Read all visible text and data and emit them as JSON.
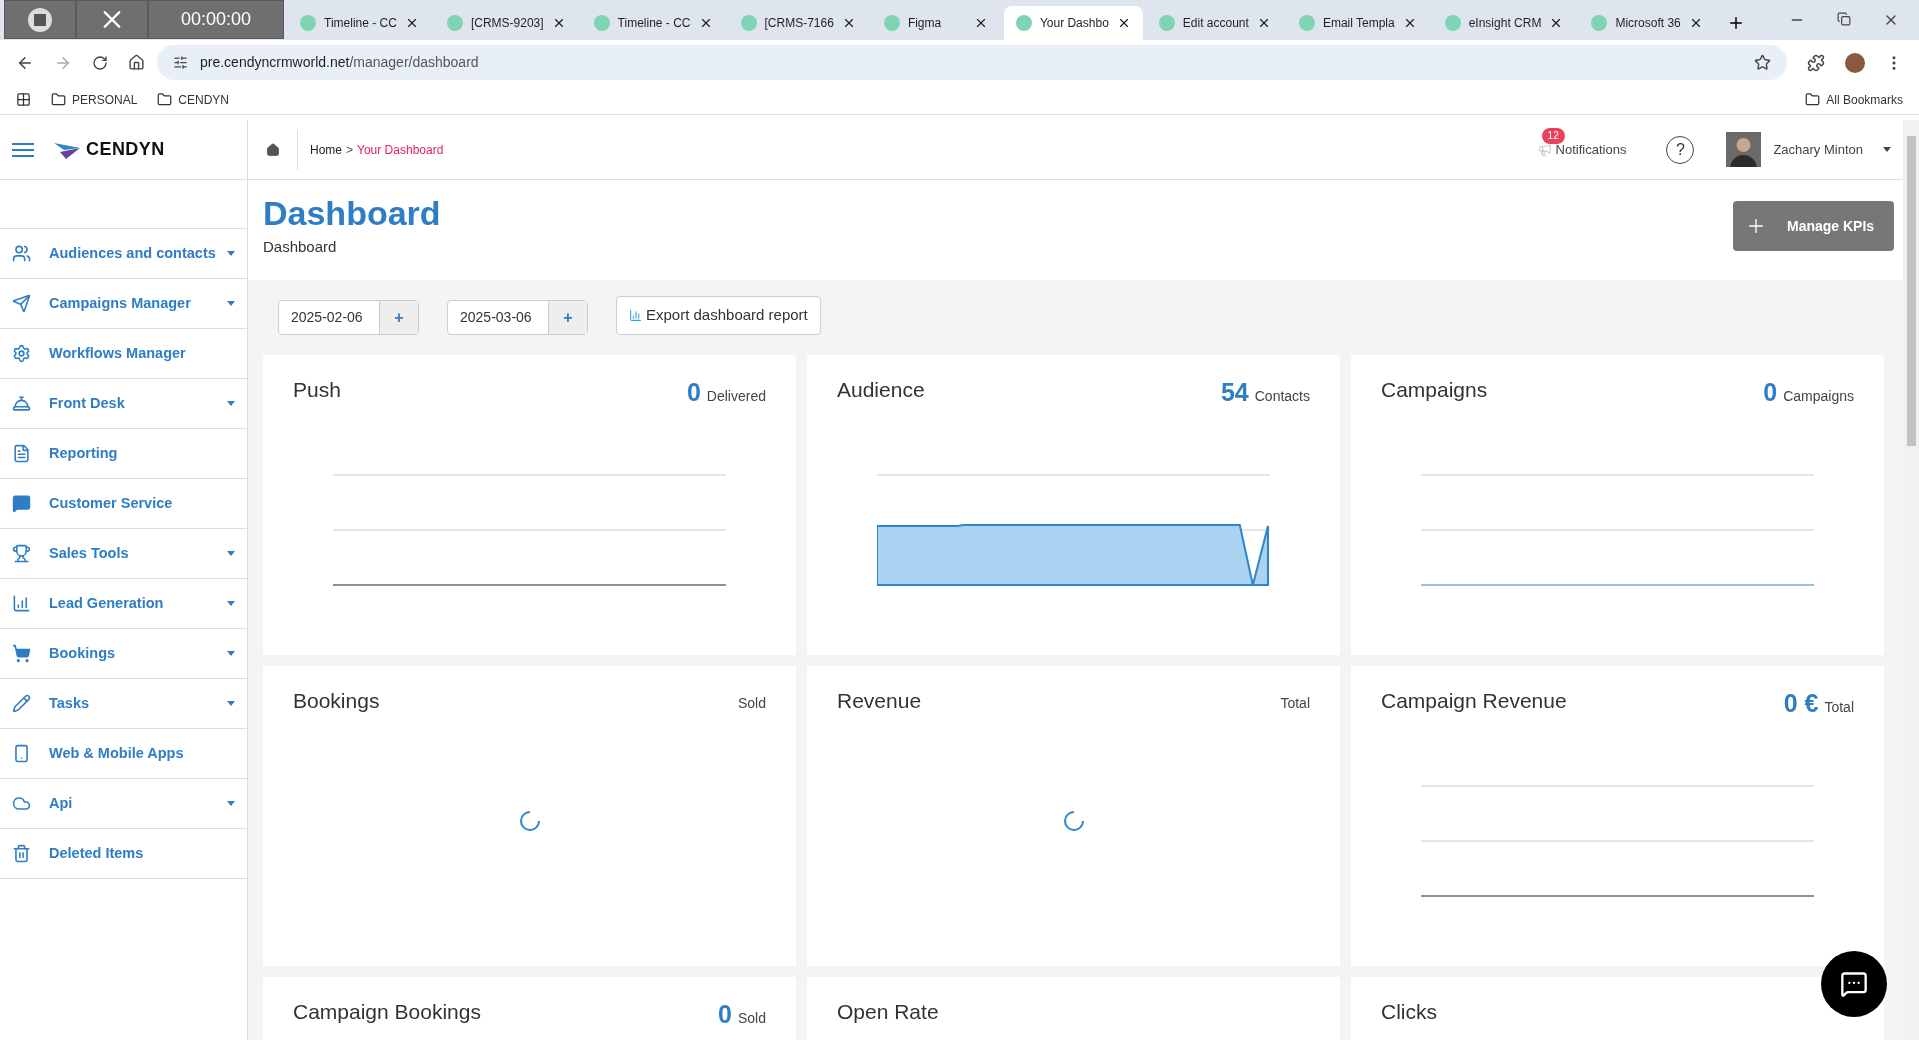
{
  "browser": {
    "recorder": {
      "time": "00:00:00"
    },
    "tabs": [
      {
        "title": "Timeline - CC",
        "selected": false
      },
      {
        "title": "[CRMS-9203]",
        "selected": false
      },
      {
        "title": "Timeline - CC",
        "selected": false
      },
      {
        "title": "[CRMS-7166",
        "selected": false
      },
      {
        "title": "Figma",
        "selected": false
      },
      {
        "title": "Your Dashbo",
        "selected": true
      },
      {
        "title": "Edit account",
        "selected": false
      },
      {
        "title": "Email Templa",
        "selected": false
      },
      {
        "title": "eInsight CRM",
        "selected": false
      },
      {
        "title": "Microsoft 36",
        "selected": false
      }
    ],
    "url": {
      "host": "pre.cendyncrmworld.net",
      "path": "/manager/dashboard"
    },
    "bookmarks": [
      "PERSONAL",
      "CENDYN"
    ],
    "all_bookmarks": "All Bookmarks"
  },
  "app": {
    "logo": "CENDYN",
    "breadcrumb": {
      "home": "Home",
      "separator": ">",
      "current": "Your Dashboard"
    },
    "notifications": {
      "label": "Notifications",
      "count": "12"
    },
    "help": "?",
    "user": {
      "name": "Zachary Minton"
    }
  },
  "sidebar": {
    "items": [
      {
        "label": "Audiences and contacts",
        "has_submenu": true
      },
      {
        "label": "Campaigns Manager",
        "has_submenu": true
      },
      {
        "label": "Workflows Manager",
        "has_submenu": false
      },
      {
        "label": "Front Desk",
        "has_submenu": true
      },
      {
        "label": "Reporting",
        "has_submenu": false
      },
      {
        "label": "Customer Service",
        "has_submenu": false
      },
      {
        "label": "Sales Tools",
        "has_submenu": true
      },
      {
        "label": "Lead Generation",
        "has_submenu": true
      },
      {
        "label": "Bookings",
        "has_submenu": true
      },
      {
        "label": "Tasks",
        "has_submenu": true
      },
      {
        "label": "Web & Mobile Apps",
        "has_submenu": false
      },
      {
        "label": "Api",
        "has_submenu": true
      },
      {
        "label": "Deleted Items",
        "has_submenu": false
      }
    ]
  },
  "page": {
    "title": "Dashboard",
    "subtitle": "Dashboard",
    "manage_button": "Manage KPIs",
    "dates": [
      "2025-02-06",
      "2025-03-06"
    ],
    "date_button": "+",
    "export_button": "Export dashboard report"
  },
  "cards": [
    {
      "title": "Push",
      "value": "0",
      "unit": "Delivered",
      "kind": "empty"
    },
    {
      "title": "Audience",
      "value": "54",
      "unit": "Contacts",
      "kind": "area"
    },
    {
      "title": "Campaigns",
      "value": "0",
      "unit": "Campaigns",
      "kind": "empty_blue"
    },
    {
      "title": "Bookings",
      "unit": "Sold",
      "kind": "loading"
    },
    {
      "title": "Revenue",
      "unit": "Total",
      "kind": "loading"
    },
    {
      "title": "Campaign Revenue",
      "value": "0 €",
      "unit": "Total",
      "kind": "empty"
    },
    {
      "title": "Campaign Bookings",
      "value": "0",
      "unit": "Sold",
      "kind": "cut"
    },
    {
      "title": "Open Rate",
      "kind": "cut"
    },
    {
      "title": "Clicks",
      "kind": "cut"
    }
  ]
}
